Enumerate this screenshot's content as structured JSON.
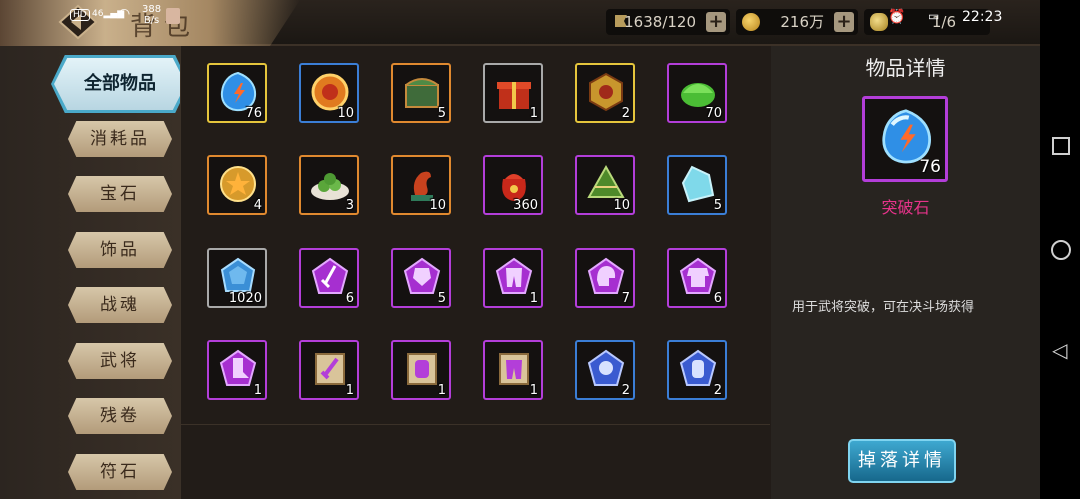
{
  "status_bar": {
    "hd": "HD",
    "signal": "46",
    "net_speed_top": "388",
    "net_speed_bottom": "B/s",
    "time": "22:23",
    "page_counter": "1/6"
  },
  "header": {
    "title": "背包",
    "stamina": "1638/120",
    "coins": "216万",
    "plus": "+"
  },
  "sidebar": {
    "active": "全部物品",
    "items": [
      "消耗品",
      "宝石",
      "饰品",
      "战魂",
      "武将",
      "残卷",
      "符石"
    ]
  },
  "grid": {
    "items": [
      {
        "name": "breakthrough-stone",
        "count": "76",
        "rarity": "gold"
      },
      {
        "name": "fire-ring",
        "count": "10",
        "rarity": "blue"
      },
      {
        "name": "green-chest",
        "count": "5",
        "rarity": "orange"
      },
      {
        "name": "gift-box",
        "count": "1",
        "rarity": "gray"
      },
      {
        "name": "gold-token",
        "count": "2",
        "rarity": "gold"
      },
      {
        "name": "green-bun",
        "count": "70",
        "rarity": "purple"
      },
      {
        "name": "gold-medal",
        "count": "4",
        "rarity": "orange"
      },
      {
        "name": "dumpling-plate",
        "count": "3",
        "rarity": "orange"
      },
      {
        "name": "dragon-statue",
        "count": "10",
        "rarity": "orange"
      },
      {
        "name": "red-pouch",
        "count": "360",
        "rarity": "purple"
      },
      {
        "name": "zongzi",
        "count": "10",
        "rarity": "purple"
      },
      {
        "name": "blue-crystal",
        "count": "5",
        "rarity": "blue"
      },
      {
        "name": "blue-gem",
        "count": "1020",
        "rarity": "gray"
      },
      {
        "name": "purple-rune-sword",
        "count": "6",
        "rarity": "purple"
      },
      {
        "name": "purple-rune-armor",
        "count": "5",
        "rarity": "purple"
      },
      {
        "name": "purple-rune-pants",
        "count": "1",
        "rarity": "purple"
      },
      {
        "name": "purple-rune-helmet",
        "count": "7",
        "rarity": "purple"
      },
      {
        "name": "purple-rune-robe",
        "count": "6",
        "rarity": "purple"
      },
      {
        "name": "purple-rune-boots",
        "count": "1",
        "rarity": "purple"
      },
      {
        "name": "scroll-sword",
        "count": "1",
        "rarity": "purple"
      },
      {
        "name": "scroll-bracer",
        "count": "1",
        "rarity": "purple"
      },
      {
        "name": "scroll-pants",
        "count": "1",
        "rarity": "purple"
      },
      {
        "name": "blue-rune-orb",
        "count": "2",
        "rarity": "blue"
      },
      {
        "name": "blue-rune-bracer",
        "count": "2",
        "rarity": "blue"
      }
    ]
  },
  "detail": {
    "title": "物品详情",
    "item_count": "76",
    "item_name": "突破石",
    "description": "用于武将突破，可在决斗场获得",
    "drop_button": "掉落详情"
  },
  "colors": {
    "gold": "#e5c53c",
    "blue": "#3b7ed6",
    "orange": "#e0892f",
    "gray": "#a9a9a9",
    "purple": "#b33ed9",
    "item_name": "#e6338a",
    "button": "#2a8bb3"
  }
}
